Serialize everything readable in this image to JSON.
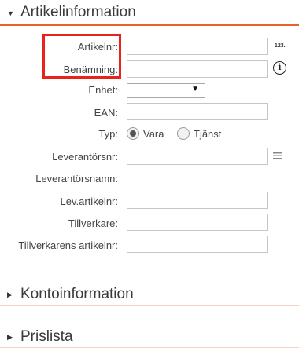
{
  "sections": {
    "artikel": {
      "title": "Artikelinformation"
    },
    "konto": {
      "title": "Kontoinformation"
    },
    "pris": {
      "title": "Prislista"
    }
  },
  "form": {
    "artikelnr_label": "Artikelnr:",
    "benamning_label": "Benämning:",
    "enhet_label": "Enhet:",
    "ean_label": "EAN:",
    "typ_label": "Typ:",
    "typ_options": [
      {
        "label": "Vara",
        "checked": true
      },
      {
        "label": "Tjänst",
        "checked": false
      }
    ],
    "leverantorsnr_label": "Leverantörsnr:",
    "leverantorsnamn_label": "Leverantörsnamn:",
    "lev_artikelnr_label": "Lev.artikelnr:",
    "tillverkare_label": "Tillverkare:",
    "tillverkarens_artikelnr_label": "Tillverkarens artikelnr:"
  },
  "icons": {
    "number_series": "123-icon",
    "info": "info-icon",
    "list": "list-icon",
    "expand": "triangle-icon"
  },
  "icon_text": {
    "number_series": "123..",
    "info": "i"
  },
  "colors": {
    "accent": "#e8632a",
    "highlight": "#e8231c",
    "divider": "#f7d2c4"
  }
}
